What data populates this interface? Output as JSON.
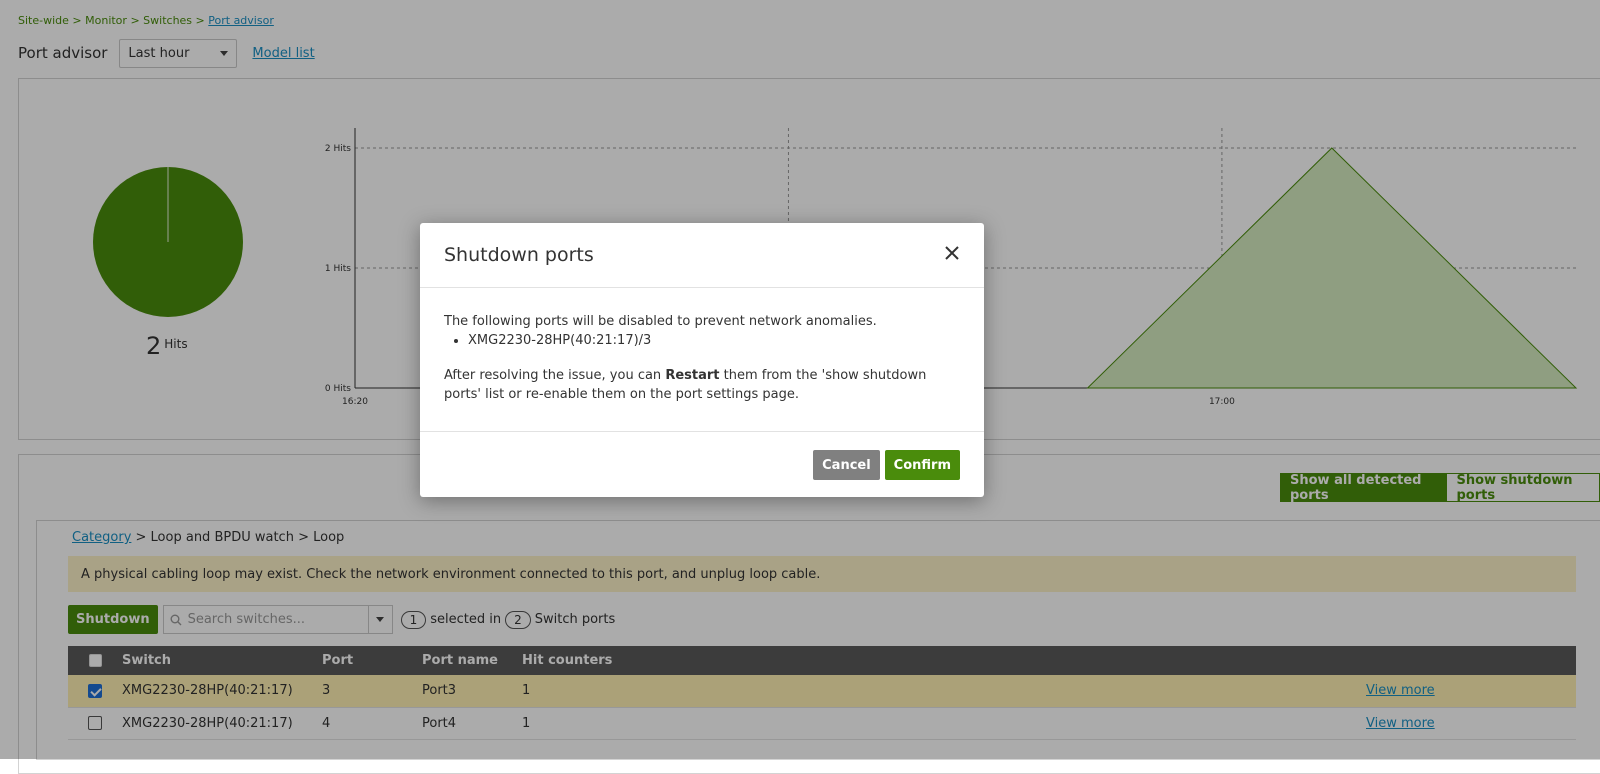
{
  "breadcrumb": {
    "items": [
      "Site-wide",
      "Monitor",
      "Switches"
    ],
    "separator": ">",
    "current": "Port advisor"
  },
  "header": {
    "title": "Port advisor",
    "time_range": "Last hour",
    "model_list_link": "Model list"
  },
  "summary": {
    "total_hits": "2",
    "hits_unit": "Hits",
    "pie_color": "#4a8c0c"
  },
  "chart_data": {
    "type": "area",
    "x_ticks": [
      "16:20",
      "17:00"
    ],
    "y_ticks": [
      "0 Hits",
      "1 Hits",
      "2 Hits"
    ],
    "ylim": [
      0,
      2
    ],
    "grid": true,
    "series": [
      {
        "points": [
          [
            0.6,
            0
          ],
          [
            0.8,
            2
          ],
          [
            1.0,
            0
          ]
        ]
      }
    ],
    "colors": {
      "line": "#4a8c0c",
      "fill": "#d6ecc0"
    }
  },
  "lower": {
    "view_toggle": {
      "active": "Show all detected ports",
      "inactive": "Show shutdown ports"
    },
    "category": {
      "link": "Category",
      "path": " > Loop and BPDU watch > Loop"
    },
    "warning": "A physical cabling loop may exist. Check the network environment connected to this port, and unplug loop cable.",
    "toolbar": {
      "shutdown_label": "Shutdown",
      "search_placeholder": "Search switches...",
      "selected_count": "1",
      "selected_text": "selected in",
      "total_count": "2",
      "total_text": "Switch ports"
    },
    "table": {
      "headers": [
        "Switch",
        "Port",
        "Port name",
        "Hit counters"
      ],
      "rows": [
        {
          "switch": "XMG2230-28HP(40:21:17)",
          "port": "3",
          "port_name": "Port3",
          "hits": "1",
          "action": "View more",
          "checked": true
        },
        {
          "switch": "XMG2230-28HP(40:21:17)",
          "port": "4",
          "port_name": "Port4",
          "hits": "1",
          "action": "View more",
          "checked": false
        }
      ]
    }
  },
  "modal": {
    "title": "Shutdown ports",
    "intro": "The following ports will be disabled to prevent network anomalies.",
    "ports": [
      "XMG2230-28HP(40:21:17)/3"
    ],
    "note_before": "After resolving the issue, you can ",
    "note_bold": "Restart",
    "note_after": " them from the 'show shutdown ports' list or re-enable them on the port settings page.",
    "cancel_label": "Cancel",
    "confirm_label": "Confirm"
  }
}
